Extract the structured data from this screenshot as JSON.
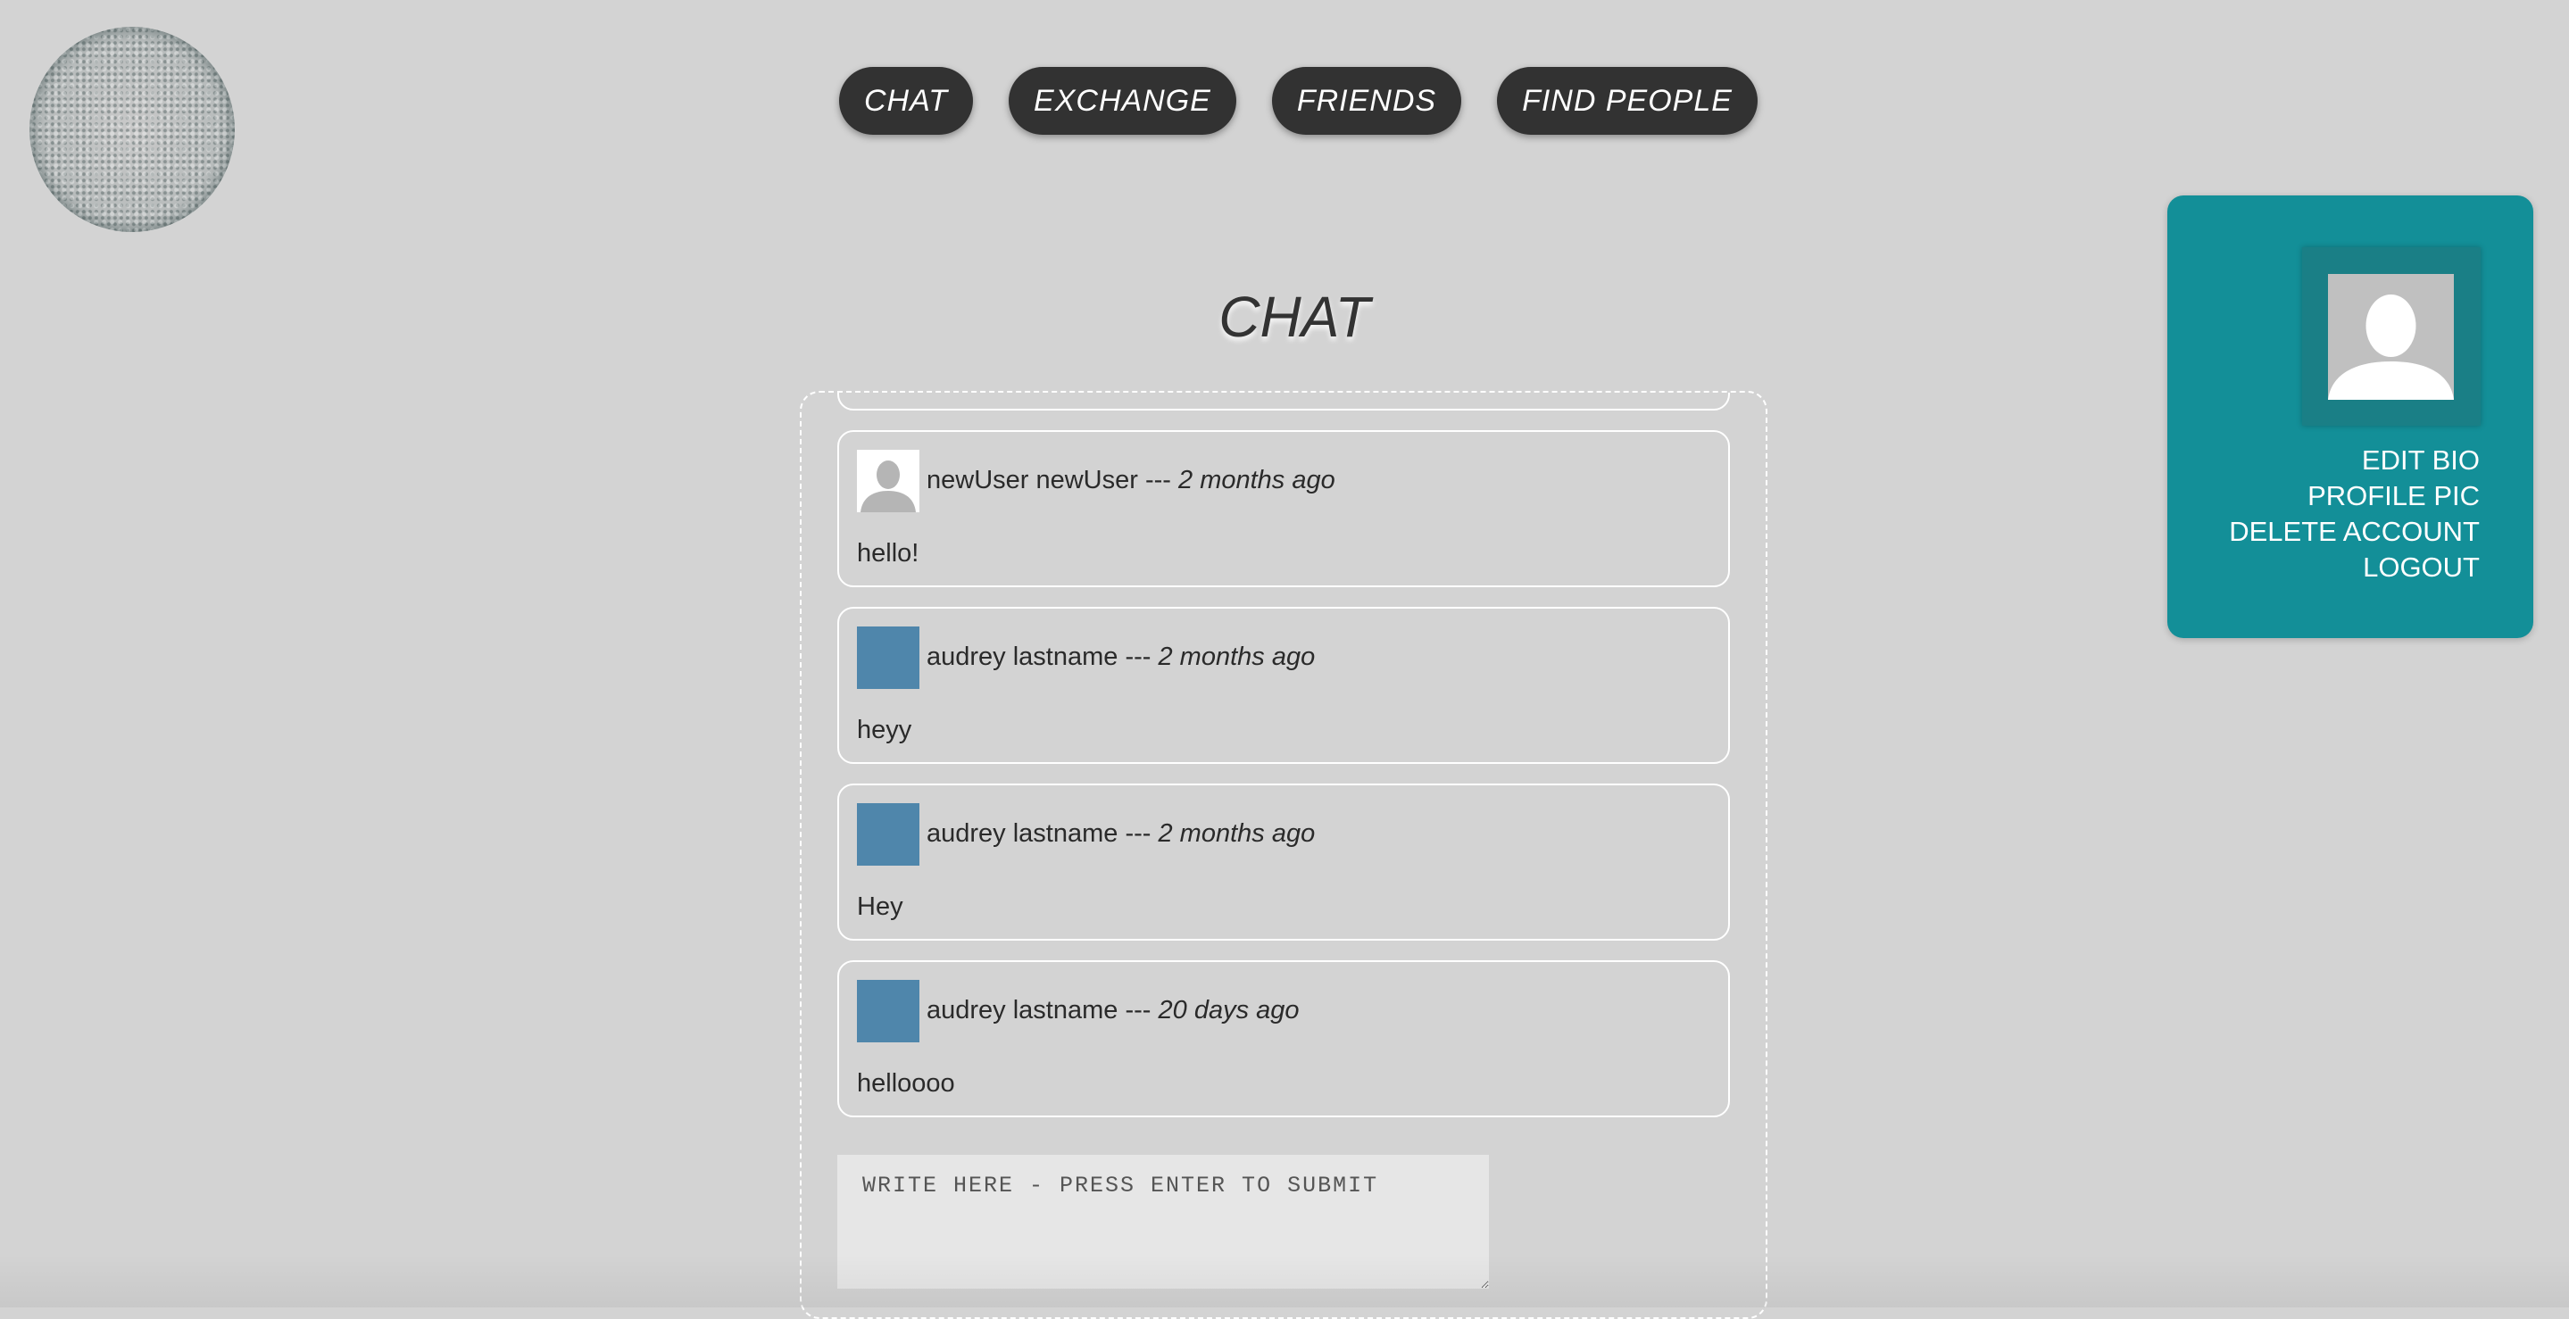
{
  "nav": {
    "items": [
      {
        "label": "CHAT"
      },
      {
        "label": "EXCHANGE"
      },
      {
        "label": "FRIENDS"
      },
      {
        "label": "FIND PEOPLE"
      }
    ]
  },
  "page": {
    "title": "CHAT"
  },
  "messages": [
    {
      "author": "newUser newUser",
      "separator": " --- ",
      "time": "2 months ago",
      "text": "hello!",
      "avatar": "default-avatar-icon"
    },
    {
      "author": "audrey lastname",
      "separator": " --- ",
      "time": "2 months ago",
      "text": "heyy",
      "avatar": "blue-avatar",
      "avatar_color": "#4f86ab"
    },
    {
      "author": "audrey lastname",
      "separator": " --- ",
      "time": "2 months ago",
      "text": "Hey",
      "avatar": "blue-avatar",
      "avatar_color": "#4f86ab"
    },
    {
      "author": "audrey lastname",
      "separator": " --- ",
      "time": "20 days ago",
      "text": "helloooo",
      "avatar": "blue-avatar",
      "avatar_color": "#4f86ab"
    }
  ],
  "chat_input": {
    "placeholder": "WRITE HERE - PRESS ENTER TO SUBMIT",
    "value": ""
  },
  "profile": {
    "menu": {
      "edit_bio": "EDIT BIO",
      "profile_pic": "PROFILE PIC",
      "delete_account": "DELETE ACCOUNT",
      "logout": "LOGOUT"
    },
    "panel_color": "#138f98"
  },
  "colors": {
    "background": "#d3d3d3",
    "nav_button": "#323232",
    "accent": "#138f98"
  }
}
